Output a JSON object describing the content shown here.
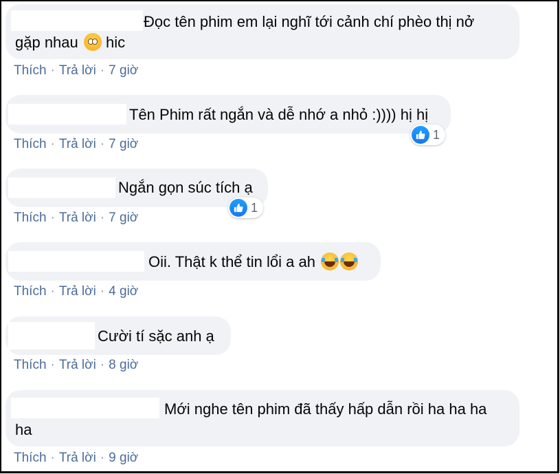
{
  "comments": [
    {
      "line1": "Đọc tên phim em lại nghĩ tới cảnh chí phèo thị nở",
      "line2": "gặp nhau",
      "line2_tail": "hic",
      "emoji": "flushed-face-icon",
      "like_label": "Thích",
      "reply_label": "Trả lời",
      "time": "7 giờ"
    },
    {
      "text": "Tên Phim rất ngắn và dễ nhớ a nhỏ :)))) hị hị",
      "reaction_count": "1",
      "like_label": "Thích",
      "reply_label": "Trả lời",
      "time": "7 giờ"
    },
    {
      "text": "Ngắn gọn súc tích ạ",
      "reaction_count": "1",
      "like_label": "Thích",
      "reply_label": "Trả lời",
      "time": "7 giờ"
    },
    {
      "text": "Oii. Thật k thể tin lổi a ah",
      "emoji": "tears-of-joy-icon",
      "like_label": "Thích",
      "reply_label": "Trả lời",
      "time": "4 giờ"
    },
    {
      "text": "Cười tí sặc anh ạ",
      "like_label": "Thích",
      "reply_label": "Trả lời",
      "time": "8 giờ"
    },
    {
      "line1": "Mới nghe tên phim đã thấy hấp dẫn rồi ha ha ha",
      "line2": "ha",
      "like_label": "Thích",
      "reply_label": "Trả lời",
      "time": "9 giờ"
    }
  ],
  "colors": {
    "bubble": "#f0f2f5",
    "action_text": "#4a6c9a",
    "like_blue": "#1877f2"
  }
}
